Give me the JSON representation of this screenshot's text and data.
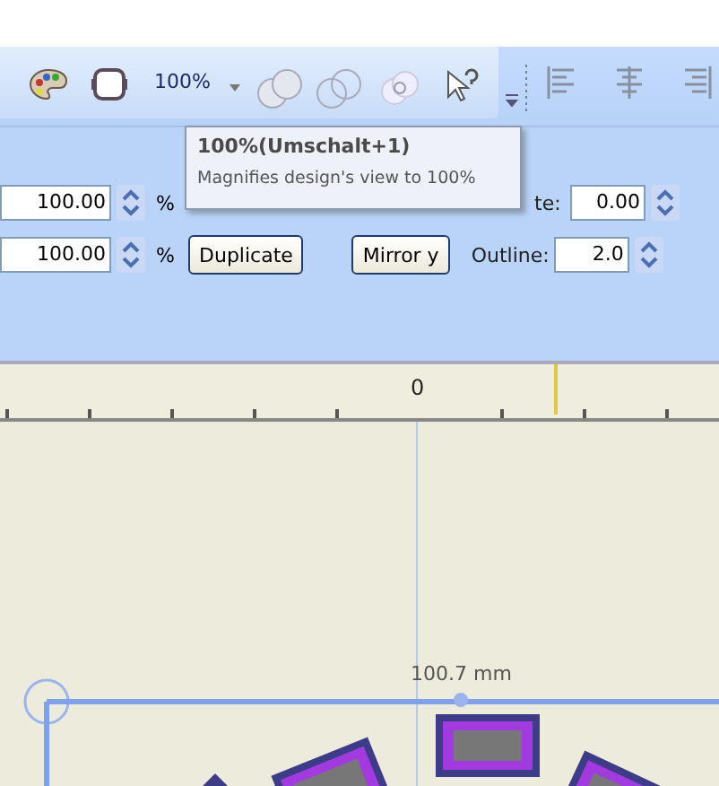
{
  "toolbar": {
    "zoom_label": "100%"
  },
  "tooltip": {
    "title": "100%(Umschalt+1)",
    "description": "Magnifies design's view to 100%"
  },
  "row_1": {
    "width_value": "100.00",
    "width_unit": "%",
    "rotate_label": "te:",
    "rotate_value": "0.00"
  },
  "row_2": {
    "height_value": "100.00",
    "height_unit": "%",
    "duplicate_button": "Duplicate",
    "mirror_y_button": "Mirror y",
    "outline_label": "Outline:",
    "outline_value": "2.0"
  },
  "ruler": {
    "zero_label": "0"
  },
  "canvas": {
    "dimension_label": "100.7 mm"
  }
}
